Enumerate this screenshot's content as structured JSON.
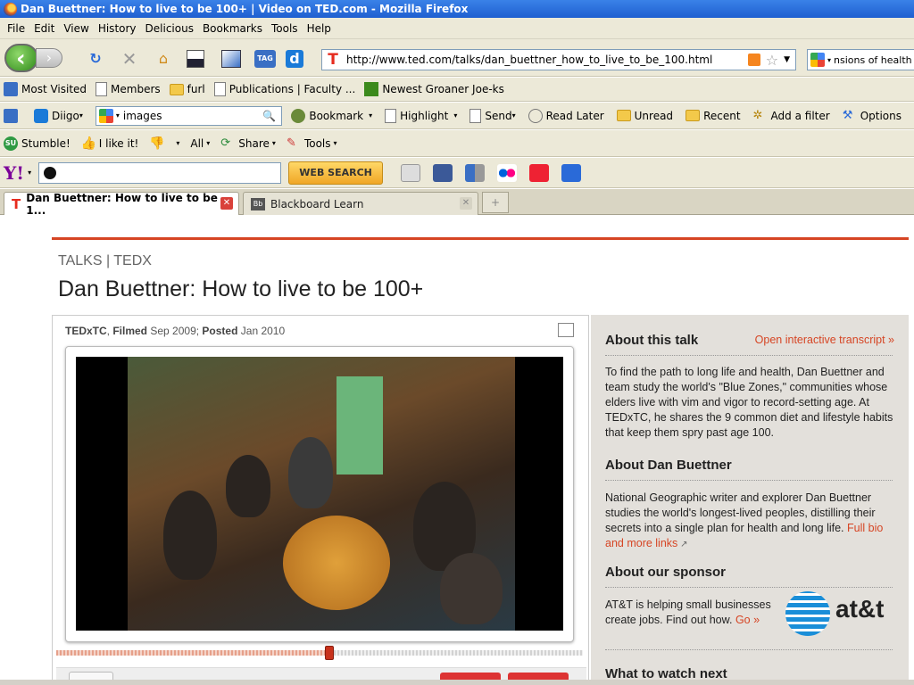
{
  "window": {
    "title": "Dan Buettner: How to live to be 100+ | Video on TED.com - Mozilla Firefox"
  },
  "menu": [
    "File",
    "Edit",
    "View",
    "History",
    "Delicious",
    "Bookmarks",
    "Tools",
    "Help"
  ],
  "navbar": {
    "url": "http://www.ted.com/talks/dan_buettner_how_to_live_to_be_100.html",
    "search_value": "nsions of health c"
  },
  "bookmarks": [
    "Most Visited",
    "Members",
    "furl",
    "Publications | Faculty ...",
    "Newest Groaner Joe-ks"
  ],
  "diigo": {
    "label": "Diigo",
    "search_value": "images",
    "items": [
      "Bookmark",
      "Highlight",
      "Send",
      "Read Later",
      "Unread",
      "Recent",
      "Add a filter",
      "Options"
    ]
  },
  "stumble": {
    "items": [
      "Stumble!",
      "I like it!",
      "All",
      "Share",
      "Tools"
    ]
  },
  "yahoo": {
    "logo": "Y!",
    "web_search": "WEB SEARCH"
  },
  "tabs": [
    {
      "label": "Dan Buettner: How to live to be 1...",
      "active": true
    },
    {
      "label": "Blackboard Learn",
      "active": false
    }
  ],
  "page": {
    "breadcrumb": "TALKS | TEDX",
    "title": "Dan Buettner: How to live to be 100+",
    "meta": {
      "event": "TEDxTC",
      "filmed_label": "Filmed",
      "filmed": "Sep 2009",
      "posted_label": "Posted",
      "posted": "Jan 2010"
    },
    "progress_fraction": 0.52
  },
  "sidebar": {
    "about_talk_heading": "About this talk",
    "transcript_link": "Open interactive transcript »",
    "about_talk_text": "To find the path to long life and health, Dan Buettner and team study the world's \"Blue Zones,\" communities whose elders live with vim and vigor to record-setting age. At TEDxTC, he shares the 9 common diet and lifestyle habits that keep them spry past age 100.",
    "about_speaker_heading": "About Dan Buettner",
    "about_speaker_text": "National Geographic writer and explorer Dan Buettner studies the world's longest-lived peoples, distilling their secrets into a single plan for health and long life.",
    "bio_link": "Full bio and more links",
    "sponsor_heading": "About our sponsor",
    "sponsor_text": "AT&T is helping small businesses create jobs. Find out how.",
    "sponsor_link": "Go »",
    "sponsor_logo": "at&t",
    "watch_next_heading": "What to watch next"
  }
}
